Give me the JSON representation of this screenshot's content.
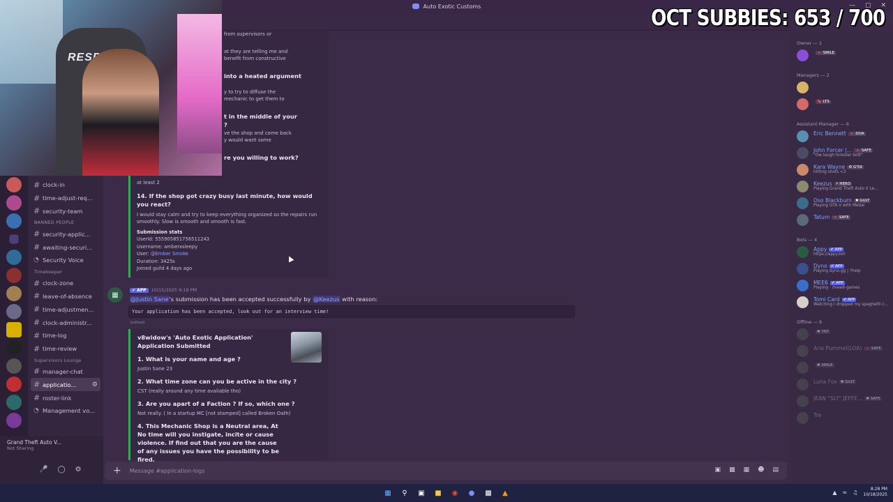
{
  "window": {
    "title": "Auto Exotic Customs",
    "controls": [
      "—",
      "▢",
      "✕"
    ]
  },
  "overlay": {
    "subbies": "OCT SUBBIES:  653 / 700"
  },
  "webcam": {
    "chair_brand": "RESPAWN"
  },
  "channels": [
    {
      "type": "text",
      "label": "clock-in"
    },
    {
      "type": "text",
      "label": "time-adjust-req..."
    },
    {
      "type": "text",
      "label": "security-team"
    },
    {
      "type": "category",
      "label": "BANNED PEOPLE"
    },
    {
      "type": "text",
      "label": "security-applic..."
    },
    {
      "type": "text",
      "label": "awaiting-securi..."
    },
    {
      "type": "voice",
      "label": "Security Voice"
    },
    {
      "type": "category",
      "label": "Timekeeper"
    },
    {
      "type": "text",
      "label": "clock-zone"
    },
    {
      "type": "text",
      "label": "leave-of-absence"
    },
    {
      "type": "text",
      "label": "time-adjustmen..."
    },
    {
      "type": "text",
      "label": "clock-administr..."
    },
    {
      "type": "text",
      "label": "time-log"
    },
    {
      "type": "text",
      "label": "time-review"
    },
    {
      "type": "category",
      "label": "Supervisors Lounge"
    },
    {
      "type": "text",
      "label": "manager-chat"
    },
    {
      "type": "text",
      "label": "applicatio...",
      "active": true
    },
    {
      "type": "text",
      "label": "roster-link"
    },
    {
      "type": "voice",
      "label": "Management vo..."
    }
  ],
  "activity": {
    "title": "Grand Theft Auto V...",
    "subtitle": "Not Sharing"
  },
  "embed_top": {
    "fragments": [
      "from supervisors or",
      "at they are telling me and",
      "benefit from constructive",
      "into a heated argument",
      "y to try to diffuse the",
      "mechanic to get them to",
      "t in the middle of your",
      "?",
      "ve the shop and come back",
      "y would want some",
      "re you willing to work?",
      "at least 2"
    ],
    "q14": "14. If the shop got crazy busy last minute, how would you react?",
    "a14": "I would stay calm and try to keep everything organized so the repairs run smoothly. Slow is smooth and smooth is fast.",
    "stats_title": "Submission stats",
    "userid": "UserId: 555905851756511243",
    "username": "Username: amberxsleepy",
    "user_label": "User: ",
    "user_mention": "@Ember Smoke",
    "duration": "Duration: 3425s",
    "joined": "Joined guild 4 days ago"
  },
  "message": {
    "app_badge": "✔ APP",
    "timestamp": "10/15/2025 9:19 PM",
    "mention1": "@Justin Sane",
    "text_mid": "'s submission has been accepted successfully by ",
    "mention2": "@Keezus",
    "text_end": " with reason:",
    "code": "Your application has been accepted, look out for an interview time!",
    "edited": "(edited)"
  },
  "embed_bottom": {
    "title": "v8widow's 'Auto Exotic Application' Application Submitted",
    "q1": "1. What is your name and age ?",
    "a1": "Justin Sane 23",
    "q2": "2. What time zone can you be active in the city ?",
    "a2": "CST (really around any time available tho)",
    "q3": "3. Are you apart of a Faction ? If so, which one ?",
    "a3": "Not really. ( In a startup MC [not stamped] called Broken Oath)",
    "q4": "4. This Mechanic Shop is a Neutral area, At No time will you instigate, incite or cause violence. If find out that you are the cause of any issues you have the possibility to be fired."
  },
  "composer": {
    "placeholder": "Message #application-logs"
  },
  "members": {
    "groups": [
      {
        "label": "Owner — 1",
        "items": [
          {
            "name": "",
            "tag": "🔺 SMILE",
            "color": "#8a4fd6"
          }
        ]
      },
      {
        "label": "Managers — 2",
        "items": [
          {
            "name": "",
            "tag": "",
            "color": "#d8b36a"
          },
          {
            "name": "",
            "tag": "🔖 LTS",
            "color": "#d36a6a"
          }
        ]
      },
      {
        "label": "Assistant Manager — 6",
        "items": [
          {
            "name": "Eric Bennett",
            "tag": "🔺 DOA",
            "color": "#5b8fb0"
          },
          {
            "name": "John Forcer (...",
            "tag": "🔺 SAFE",
            "status": "\"Ow laugh forester bott\"",
            "color": "#4d4a66"
          },
          {
            "name": "Kara Wayne",
            "tag": "⚙ G'59",
            "status": "hitting shots <3",
            "color": "#c98a6a"
          },
          {
            "name": "Keezus",
            "tag": "⚡ HERO",
            "status": "Playing Grand Theft Auto V Le...",
            "color": "#8a8a70"
          },
          {
            "name": "Oso Blackburn",
            "tag": "✖ GULT",
            "status": "Playing GTA V with Medal",
            "color": "#3b6c8a"
          },
          {
            "name": "Tatum",
            "tag": "🔺 SAFE",
            "color": "#5a6a7a"
          }
        ]
      },
      {
        "label": "Bots — 4",
        "items": [
          {
            "name": "Appy",
            "tag": "✔ APP",
            "app": true,
            "status": "https://appy.bot",
            "color": "#2d5a45"
          },
          {
            "name": "Dyno",
            "tag": "✔ APP",
            "app": true,
            "status": "Playing dyno.gg | ?help",
            "color": "#3b4f8c"
          },
          {
            "name": "MEE6",
            "tag": "✔ APP",
            "app": true,
            "status": "Playing · /mee6-games",
            "color": "#3b6ec9"
          },
          {
            "name": "Tomi Card",
            "tag": "✔ APP",
            "app": true,
            "status": "Watching I dropped my spaghetti c...",
            "color": "#d8d0c8"
          }
        ]
      },
      {
        "label": "Offline — 6",
        "items": [
          {
            "name": "",
            "tag": "✖ YNT",
            "color": "#555"
          },
          {
            "name": "Aria Pummel(LOA)",
            "tag": "🔺 SAFE",
            "color": "#555"
          },
          {
            "name": "",
            "tag": "✖ SMILE",
            "color": "#555"
          },
          {
            "name": "Luna Fox",
            "tag": "✖ GULT",
            "color": "#555"
          },
          {
            "name": "JEAN \"SLY\" JEFFE...",
            "tag": "✖ SAFE",
            "color": "#555"
          },
          {
            "name": "Tre",
            "tag": "",
            "color": "#555"
          }
        ]
      }
    ]
  },
  "taskbar": {
    "time": "8:28 PM",
    "date": "10/18/2025"
  },
  "colors": {
    "background": "#3b2a48",
    "accent": "#5865f2",
    "embed_bar": "#3ba55d",
    "member_name": "#7fa6ff"
  },
  "icons": {
    "server_list": [
      "server-icon"
    ],
    "composer": [
      "gift-icon",
      "gif-icon",
      "sticker-icon",
      "emoji-icon",
      "apps-icon"
    ]
  }
}
